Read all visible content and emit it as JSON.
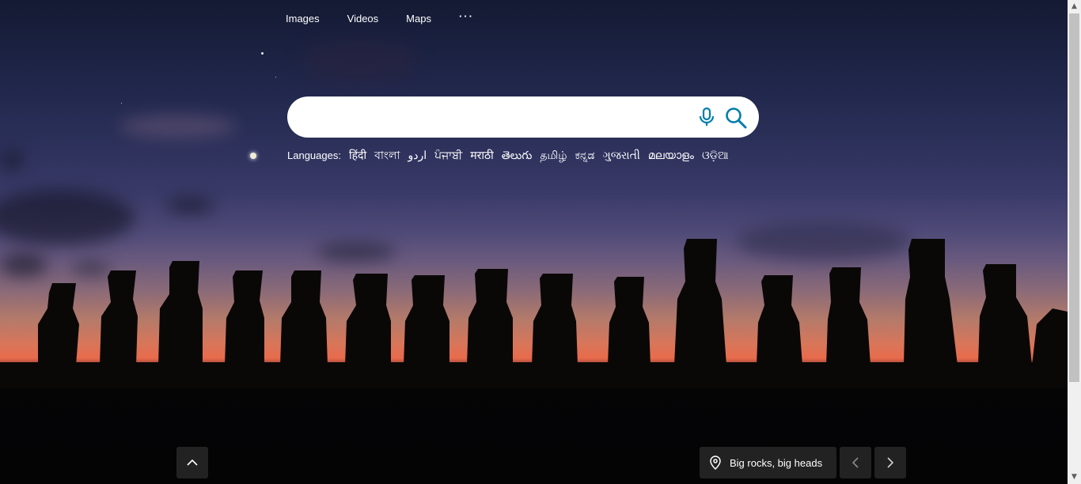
{
  "nav": {
    "items": [
      {
        "label": "Images"
      },
      {
        "label": "Videos"
      },
      {
        "label": "Maps"
      }
    ],
    "more_label": "···"
  },
  "search": {
    "value": "",
    "placeholder": "",
    "mic_icon": "microphone-icon",
    "search_icon": "magnifier-icon",
    "accent_color": "#007daa"
  },
  "languages": {
    "label": "Languages:",
    "items": [
      "हिंदी",
      "বাংলা",
      "اردو",
      "ਪੰਜਾਬੀ",
      "मराठी",
      "తెలుగు",
      "தமிழ்",
      "ಕನ್ನಡ",
      "ગુજરાતી",
      "മലയാളം",
      "ଓଡ଼ିଆ"
    ]
  },
  "footer": {
    "scroll_up_icon": "chevron-up-icon",
    "location_icon": "location-pin-icon",
    "location_text": "Big rocks, big heads",
    "prev_icon": "chevron-left-icon",
    "next_icon": "chevron-right-icon"
  }
}
